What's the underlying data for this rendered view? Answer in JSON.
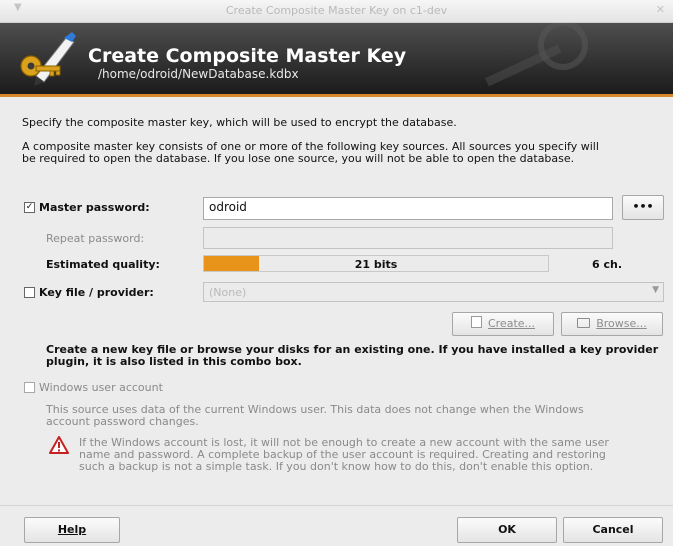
{
  "window": {
    "title": "Create Composite Master Key on c1-dev"
  },
  "banner": {
    "heading": "Create Composite Master Key",
    "path": "/home/odroid/NewDatabase.kdbx"
  },
  "intro": {
    "line1": "Specify the composite master key, which will be used to encrypt the database.",
    "line2a": "A composite master key consists of one or more of the following key sources. All sources you specify will",
    "line2b": "be required to open the database.  If you lose one source, you will not be able to open the database."
  },
  "password": {
    "checkbox_label": "Master password:",
    "checked": true,
    "value": "odroid",
    "reveal_label": "•••",
    "repeat_label": "Repeat password:",
    "repeat_value": "",
    "quality_label": "Estimated quality:",
    "quality_text": "21 bits",
    "quality_fraction": 0.16,
    "length_text": "6 ch."
  },
  "keyfile": {
    "checkbox_label": "Key file / provider:",
    "checked": false,
    "select_value": "(None)",
    "create_label": "Create...",
    "browse_label": "Browse...",
    "help_line1": "Create a new key file or browse your disks for an existing one. If you have installed a key provider",
    "help_line2": "plugin, it is also listed in this combo box."
  },
  "winuser": {
    "checkbox_label": "Windows user account",
    "checked": false,
    "desc1": "This source uses data of the current Windows user. This data does not change when the Windows",
    "desc2": "account password changes.",
    "warn1": "If the Windows account is lost, it will not be enough to create a new account with the same user",
    "warn2": "name and password. A complete backup of the user account is required. Creating and restoring",
    "warn3": "such a backup is not a simple task. If you don't know how to do this, don't enable this option."
  },
  "footer": {
    "help_label": "Help",
    "ok_label": "OK",
    "cancel_label": "Cancel"
  },
  "colors": {
    "accent": "#e8931a",
    "banner_dark": "#1b1b1b",
    "warning": "#c62020"
  }
}
